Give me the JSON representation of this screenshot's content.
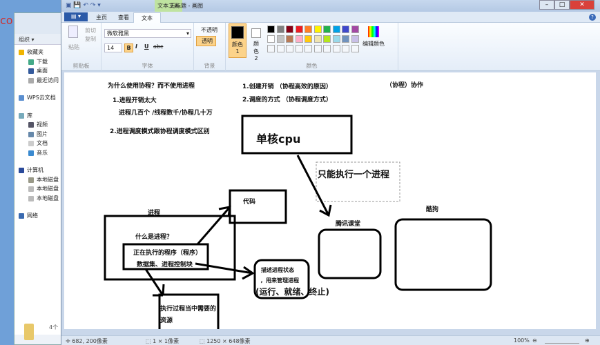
{
  "explorer": {
    "toolbar_organize": "组织 ▾",
    "items": [
      {
        "label": "收藏夹",
        "color": "#f0b400",
        "sub": false
      },
      {
        "label": "下载",
        "color": "#4a8",
        "sub": true
      },
      {
        "label": "桌面",
        "color": "#345a9c",
        "sub": true
      },
      {
        "label": "最近访问",
        "color": "#aaa",
        "sub": true
      },
      {
        "label": "WPS云文档",
        "color": "#5b8fd0",
        "sub": false,
        "gap": true
      },
      {
        "label": "库",
        "color": "#7ab",
        "sub": false,
        "gap": true
      },
      {
        "label": "视频",
        "color": "#556",
        "sub": true
      },
      {
        "label": "图片",
        "color": "#68a",
        "sub": true
      },
      {
        "label": "文档",
        "color": "#ccc",
        "sub": true
      },
      {
        "label": "音乐",
        "color": "#3a8ad0",
        "sub": true
      },
      {
        "label": "计算机",
        "color": "#2a4a9a",
        "sub": false,
        "gap": true
      },
      {
        "label": "本地磁盘",
        "color": "#998",
        "sub": true
      },
      {
        "label": "本地磁盘",
        "color": "#bbb",
        "sub": true
      },
      {
        "label": "本地磁盘",
        "color": "#bbb",
        "sub": true
      },
      {
        "label": "网络",
        "color": "#3a6ab0",
        "sub": false,
        "gap": true
      }
    ],
    "count": "4个"
  },
  "paint": {
    "context_tab": "文本工具",
    "title": "无标题 - 画图",
    "tabs": [
      "主页",
      "查看",
      "文本"
    ],
    "clipboard": {
      "paste": "粘贴",
      "cut": "剪切",
      "copy": "复制",
      "label": "剪贴板"
    },
    "font": {
      "family": "微软雅黑",
      "size": "14",
      "bold": "B",
      "italic": "I",
      "underline": "U",
      "strike": "abc",
      "label": "字体"
    },
    "background": {
      "opaque": "不透明",
      "transparent": "透明",
      "label": "背景"
    },
    "colors": {
      "color1": "颜色 1",
      "color2": "颜色 2",
      "edit": "编辑颜色",
      "label": "颜色",
      "row1": [
        "#000000",
        "#7f7f7f",
        "#880015",
        "#ed1c24",
        "#ff7f27",
        "#fff200",
        "#22b14c",
        "#00a2e8",
        "#3f48cc",
        "#a349a4"
      ],
      "row2": [
        "#ffffff",
        "#c3c3c3",
        "#b97a57",
        "#ffaec9",
        "#ffc90e",
        "#efe4b0",
        "#b5e61d",
        "#99d9ea",
        "#7092be",
        "#c8bfe7"
      ]
    },
    "status": {
      "cursor": "682, 200像素",
      "selection": "1 × 1像素",
      "size": "1250 × 648像素",
      "zoom": "100%"
    }
  },
  "drawing": {
    "q_title": "为什么使用协程？而不使用进程",
    "q1": "1.进程开销太大",
    "q1_detail": "进程几百个 /线程数千/协程几十万",
    "q2": "2.进程调度模式跟协程调度模式区别",
    "a1": "1.创建开销 （协程高效的原因）",
    "a2": "2.调度的方式 （协程调度方式）",
    "coop": "（协程）协作",
    "cpu": "单核cpu",
    "one_proc": "只能执行一个进程",
    "tencent": "腾讯课堂",
    "kugou": "酷狗",
    "code": "代码",
    "process": "进程",
    "what": "什么是进程？",
    "running": "正在执行的程序（程序）",
    "dataset": "数据集、进程控制块",
    "desc1": "描述进程状态",
    "desc2": "，用来管理进程",
    "states": "(运行、就绪、终止)",
    "res1": "执行过程当中需要的",
    "res2": "资源"
  }
}
